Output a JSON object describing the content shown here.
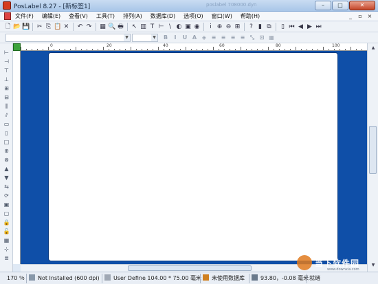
{
  "window": {
    "title": "PosLabel 8.27 - [新标签1]",
    "ghost_title": "poslabel 708000.dyn",
    "minimize_label": "–",
    "maximize_label": "□",
    "close_label": "✕"
  },
  "menubar": {
    "items": [
      {
        "label": "文件(F)"
      },
      {
        "label": "编辑(E)"
      },
      {
        "label": "查看(V)"
      },
      {
        "label": "工具(T)"
      },
      {
        "label": "排列(A)"
      },
      {
        "label": "数据库(D)"
      },
      {
        "label": "选项(O)"
      },
      {
        "label": "窗口(W)"
      },
      {
        "label": "帮助(H)"
      }
    ],
    "controls": [
      "_",
      "▫",
      "×"
    ]
  },
  "toolbar1": {
    "icons": [
      "new-icon",
      "open-icon",
      "save-icon",
      "cut-icon",
      "copy-icon",
      "paste-icon",
      "delete-icon",
      "undo-icon",
      "redo-icon",
      "table-icon",
      "preview-icon",
      "print-icon",
      "select-tool-icon",
      "barcode-tool-icon",
      "text-tool-icon",
      "hline-tool-icon",
      "line-tool-icon",
      "shape-tool-icon",
      "image-tool-icon",
      "rfid-tool-icon",
      "info-icon",
      "zoom-in-icon",
      "zoom-out-icon",
      "zoom-fit-icon",
      "help-icon",
      "db-icon",
      "copy-style-icon",
      "page-icon",
      "first-page-icon",
      "prev-page-icon",
      "next-page-icon",
      "last-page-icon"
    ],
    "glyphs": [
      "🗋",
      "📂",
      "💾",
      "✂",
      "⎘",
      "📋",
      "✕",
      "↶",
      "↷",
      "▦",
      "🔍",
      "🖶",
      "↖",
      "▥",
      "T",
      "⊢",
      "\\",
      "◐",
      "▣",
      "◉",
      "ⅰ",
      "⊕",
      "⊖",
      "⊞",
      "?",
      "▮",
      "⧉",
      "▯",
      "⏮",
      "◀",
      "▶",
      "⏭"
    ]
  },
  "toolbar2": {
    "font_combo_value": "",
    "size_combo_value": "",
    "icons": [
      "bold-icon",
      "italic-icon",
      "underline-icon",
      "text-box-icon",
      "fill-icon",
      "align-left-icon",
      "align-center-icon",
      "align-right-icon",
      "align-justify-icon",
      "resize-icon",
      "group-icon",
      "grid-icon"
    ],
    "glyphs": [
      "B",
      "I",
      "U",
      "A",
      "◈",
      "≡",
      "≡",
      "≡",
      "≡",
      "⤡",
      "⊡",
      "▦"
    ]
  },
  "ruler": {
    "ticks": [
      "0",
      "20",
      "40",
      "60",
      "80",
      "100"
    ]
  },
  "status": {
    "zoom": "170 ％",
    "printer": "Not Installed (600 dpi)",
    "paper": "User Define  104.00 * 75.00 毫米",
    "database": "未使用数据库",
    "coords": "93.80，-0.08 毫米",
    "state": "就绪"
  },
  "watermark": {
    "text": "当下软件园",
    "sub": "www.downxia.com"
  },
  "colors": {
    "canvas": "#0f4fa8",
    "label_page": "#ffffff",
    "ruler_corner": "#3ca33c"
  }
}
